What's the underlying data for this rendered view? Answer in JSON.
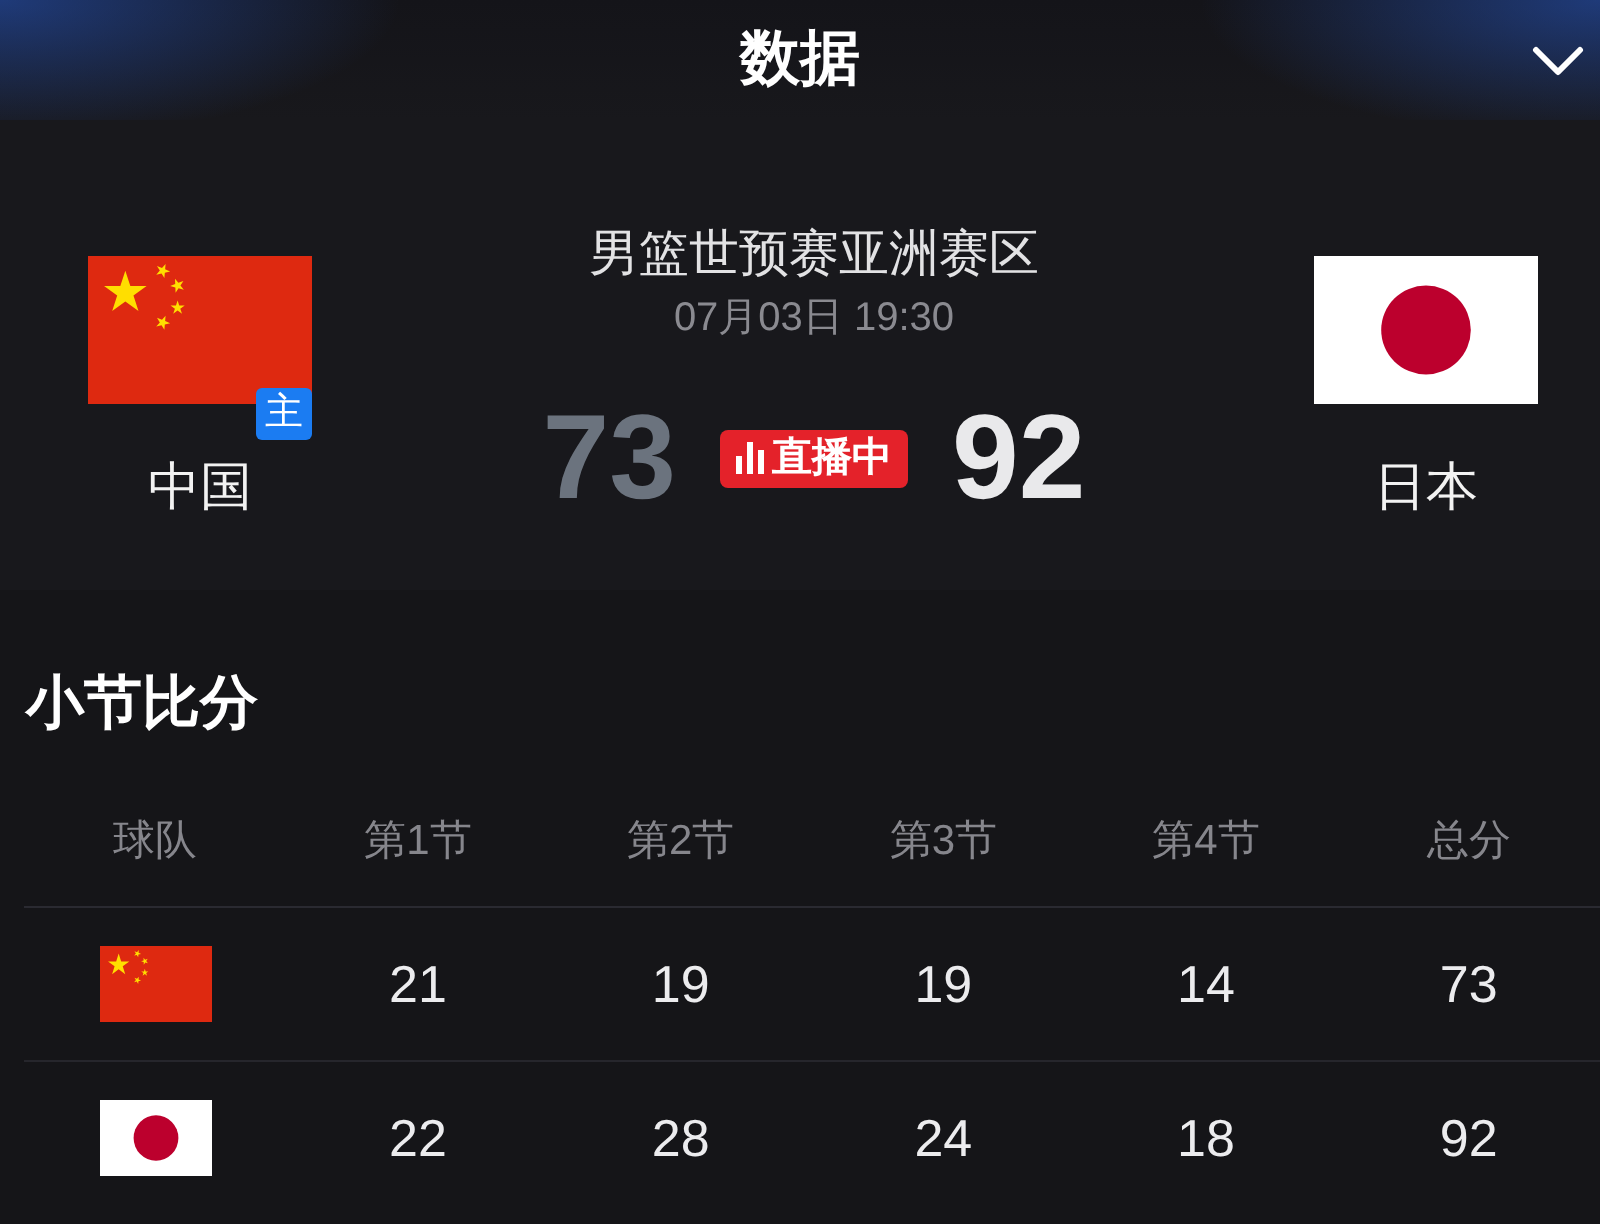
{
  "header": {
    "title": "数据"
  },
  "match": {
    "competition": "男篮世预赛亚洲赛区",
    "datetime": "07月03日 19:30",
    "live_badge": "直播中",
    "teams": [
      {
        "kind": "china",
        "name": "中国",
        "badge": "主",
        "score": "73",
        "leading": false
      },
      {
        "kind": "japan",
        "name": "日本",
        "score": "92",
        "leading": true
      }
    ]
  },
  "quarter_scores": {
    "title": "小节比分",
    "team_header": "球队",
    "columns": [
      "第1节",
      "第2节",
      "第3节",
      "第4节",
      "总分"
    ],
    "rows": [
      {
        "kind": "china",
        "cells": [
          "21",
          "19",
          "19",
          "14",
          "73"
        ]
      },
      {
        "kind": "japan",
        "cells": [
          "22",
          "28",
          "24",
          "18",
          "92"
        ]
      }
    ]
  }
}
